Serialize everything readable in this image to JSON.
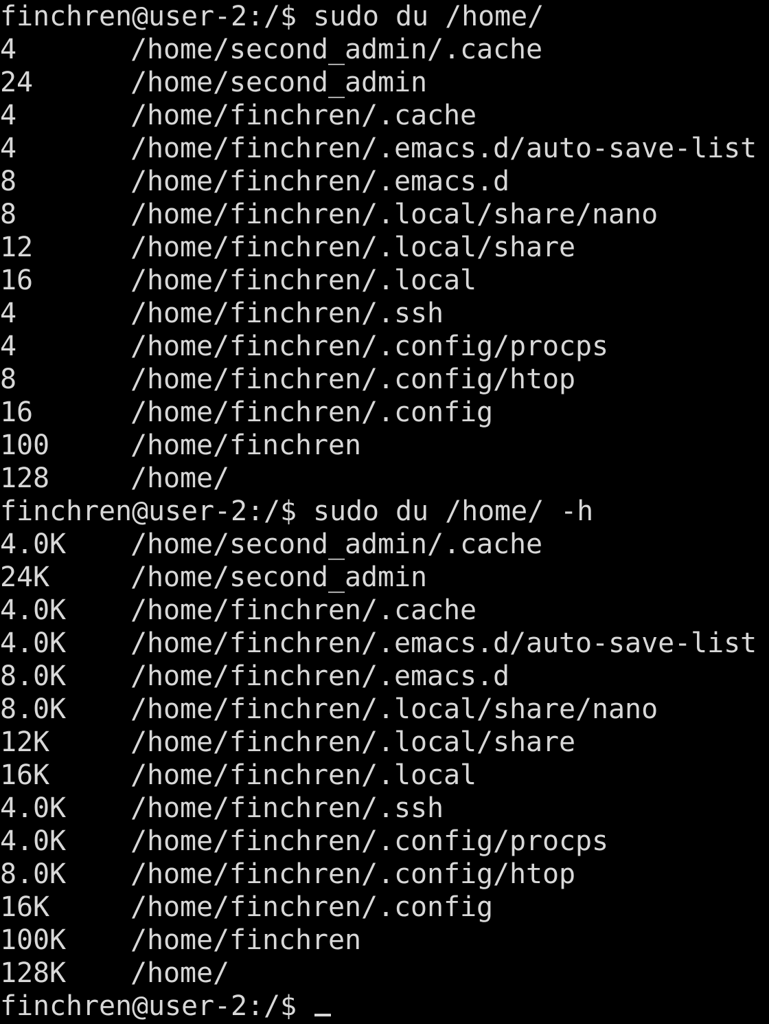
{
  "terminal": {
    "prompt": "finchren@user-2:/$ ",
    "commands": {
      "first": "sudo du /home/",
      "second": "sudo du /home/ -h"
    },
    "output_plain": [
      {
        "size": "4",
        "path": "/home/second_admin/.cache"
      },
      {
        "size": "24",
        "path": "/home/second_admin"
      },
      {
        "size": "4",
        "path": "/home/finchren/.cache"
      },
      {
        "size": "4",
        "path": "/home/finchren/.emacs.d/auto-save-list"
      },
      {
        "size": "8",
        "path": "/home/finchren/.emacs.d"
      },
      {
        "size": "8",
        "path": "/home/finchren/.local/share/nano"
      },
      {
        "size": "12",
        "path": "/home/finchren/.local/share"
      },
      {
        "size": "16",
        "path": "/home/finchren/.local"
      },
      {
        "size": "4",
        "path": "/home/finchren/.ssh"
      },
      {
        "size": "4",
        "path": "/home/finchren/.config/procps"
      },
      {
        "size": "8",
        "path": "/home/finchren/.config/htop"
      },
      {
        "size": "16",
        "path": "/home/finchren/.config"
      },
      {
        "size": "100",
        "path": "/home/finchren"
      },
      {
        "size": "128",
        "path": "/home/"
      }
    ],
    "output_human": [
      {
        "size": "4.0K",
        "path": "/home/second_admin/.cache"
      },
      {
        "size": "24K",
        "path": "/home/second_admin"
      },
      {
        "size": "4.0K",
        "path": "/home/finchren/.cache"
      },
      {
        "size": "4.0K",
        "path": "/home/finchren/.emacs.d/auto-save-list"
      },
      {
        "size": "8.0K",
        "path": "/home/finchren/.emacs.d"
      },
      {
        "size": "8.0K",
        "path": "/home/finchren/.local/share/nano"
      },
      {
        "size": "12K",
        "path": "/home/finchren/.local/share"
      },
      {
        "size": "16K",
        "path": "/home/finchren/.local"
      },
      {
        "size": "4.0K",
        "path": "/home/finchren/.ssh"
      },
      {
        "size": "4.0K",
        "path": "/home/finchren/.config/procps"
      },
      {
        "size": "8.0K",
        "path": "/home/finchren/.config/htop"
      },
      {
        "size": "16K",
        "path": "/home/finchren/.config"
      },
      {
        "size": "100K",
        "path": "/home/finchren"
      },
      {
        "size": "128K",
        "path": "/home/"
      }
    ],
    "colors": {
      "background": "#000000",
      "foreground": "#d8d8d8"
    }
  }
}
